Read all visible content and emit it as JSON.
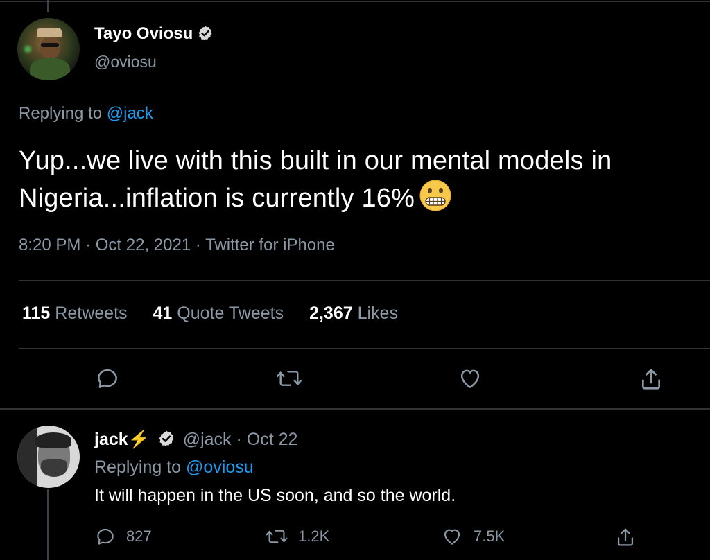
{
  "main_tweet": {
    "display_name": "Tayo Oviosu",
    "handle": "@oviosu",
    "replying_prefix": "Replying to",
    "replying_to": "@jack",
    "text": "Yup...we live with this built in our mental models in Nigeria...inflation is currently 16%",
    "emoji": "grimacing-face",
    "time": "8:20 PM",
    "date": "Oct 22, 2021",
    "source": "Twitter for iPhone",
    "separator": "·",
    "stats": {
      "retweets_count": "115",
      "retweets_label": "Retweets",
      "quotes_count": "41",
      "quotes_label": "Quote Tweets",
      "likes_count": "2,367",
      "likes_label": "Likes"
    },
    "actions": [
      "reply-icon",
      "retweet-icon",
      "like-icon",
      "share-icon"
    ]
  },
  "reply_tweet": {
    "display_name": "jack",
    "name_emoji": "⚡",
    "handle": "@jack",
    "separator": "·",
    "date": "Oct 22",
    "replying_prefix": "Replying to",
    "replying_to": "@oviosu",
    "text": "It will happen in the US soon, and so the world.",
    "counts": {
      "replies": "827",
      "retweets": "1.2K",
      "likes": "7.5K"
    }
  },
  "colors": {
    "background": "#000000",
    "text_primary": "#ffffff",
    "text_secondary": "#8b98a5",
    "link": "#1d9bf0",
    "divider": "#2f3336"
  }
}
